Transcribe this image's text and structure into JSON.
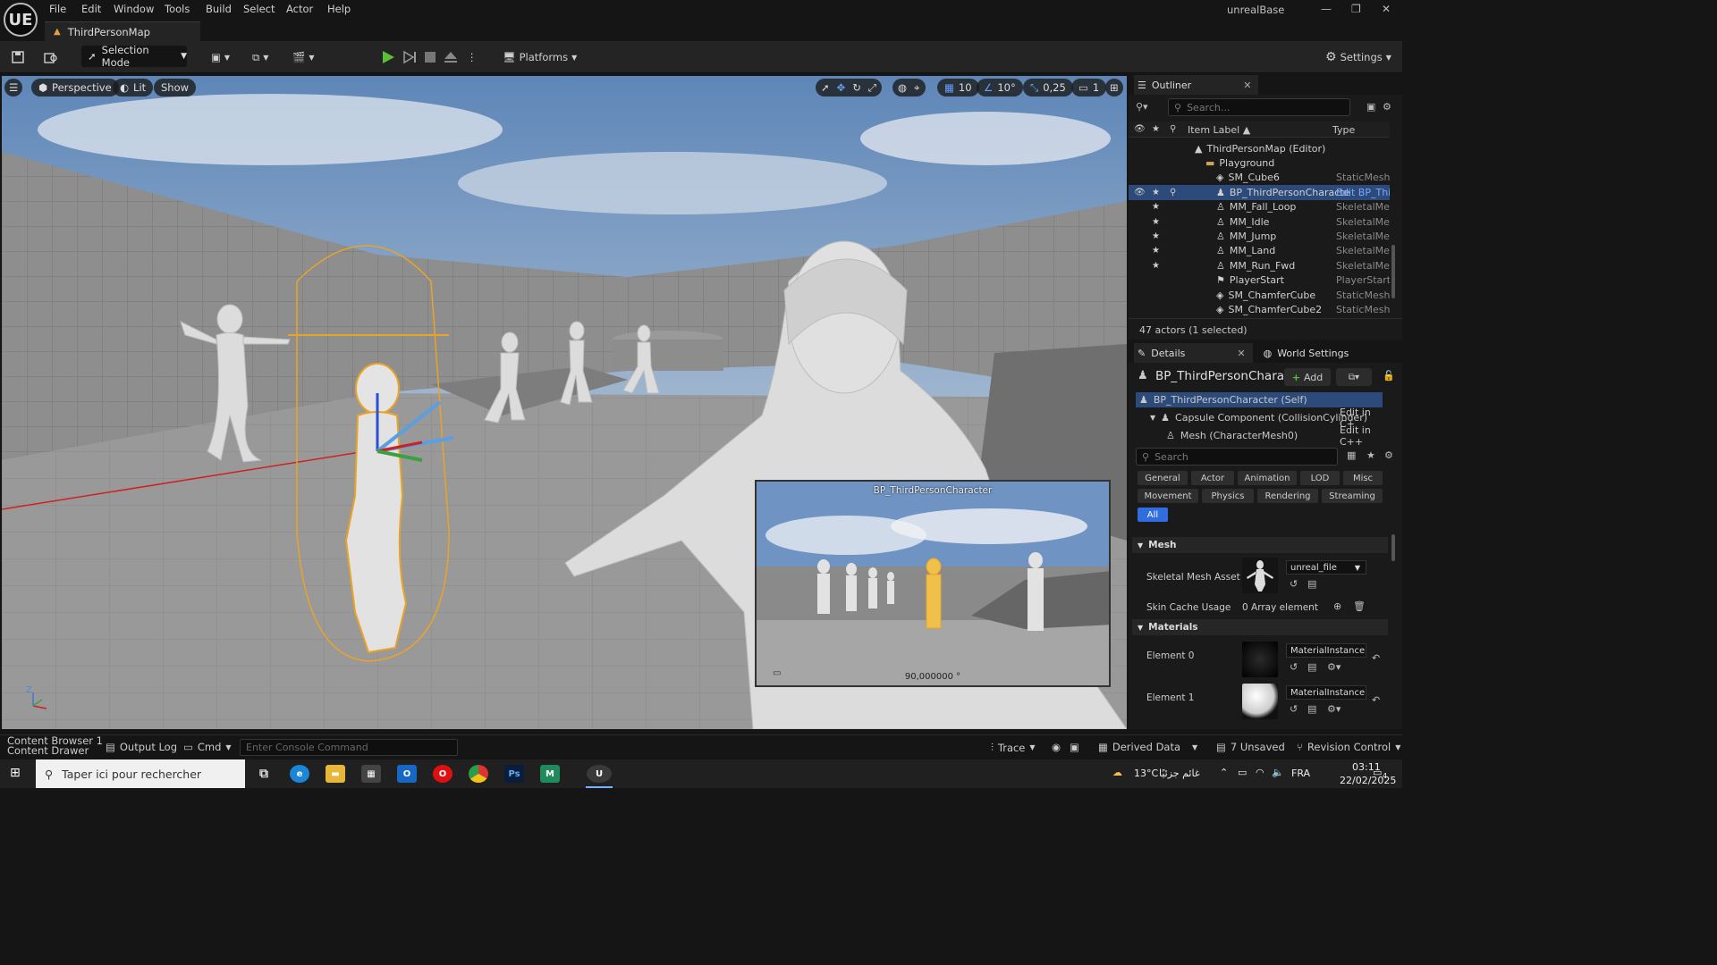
{
  "app": {
    "title": "unrealBase",
    "logo": "UE"
  },
  "menu": [
    "File",
    "Edit",
    "Window",
    "Tools",
    "Build",
    "Select",
    "Actor",
    "Help"
  ],
  "tab": {
    "label": "ThirdPersonMap"
  },
  "toolbar": {
    "selection_mode": "Selection Mode",
    "platforms": "Platforms",
    "settings": "Settings"
  },
  "viewport": {
    "perspective": "Perspective",
    "lit": "Lit",
    "show": "Show",
    "grid_snap": "10",
    "rot_snap": "10°",
    "scale_snap": "0,25",
    "camera_speed": "1",
    "pip_title": "BP_ThirdPersonCharacter",
    "pip_fov": "90,000000 °"
  },
  "outliner": {
    "title": "Outliner",
    "search_placeholder": "Search...",
    "col_label": "Item Label ▲",
    "col_type": "Type",
    "rows": [
      {
        "label": "ThirdPersonMap (Editor)",
        "type": "",
        "indent": 1,
        "icon": "▲"
      },
      {
        "label": "Playground",
        "type": "",
        "indent": 2,
        "icon": "▬",
        "folder": true
      },
      {
        "label": "SM_Cube6",
        "type": "StaticMeshA",
        "indent": 3,
        "icon": "◈"
      },
      {
        "label": "BP_ThirdPersonCharacte",
        "type": "Edit BP_Thir",
        "indent": 3,
        "icon": "♟",
        "selected": true
      },
      {
        "label": "MM_Fall_Loop",
        "type": "SkeletalMes",
        "indent": 3,
        "icon": "♙",
        "star": true
      },
      {
        "label": "MM_Idle",
        "type": "SkeletalMes",
        "indent": 3,
        "icon": "♙",
        "star": true
      },
      {
        "label": "MM_Jump",
        "type": "SkeletalMes",
        "indent": 3,
        "icon": "♙",
        "star": true
      },
      {
        "label": "MM_Land",
        "type": "SkeletalMes",
        "indent": 3,
        "icon": "♙",
        "star": true
      },
      {
        "label": "MM_Run_Fwd",
        "type": "SkeletalMes",
        "indent": 3,
        "icon": "♙",
        "star": true
      },
      {
        "label": "PlayerStart",
        "type": "PlayerStart",
        "indent": 3,
        "icon": "⚑"
      },
      {
        "label": "SM_ChamferCube",
        "type": "StaticMeshA",
        "indent": 3,
        "icon": "◈"
      },
      {
        "label": "SM_ChamferCube2",
        "type": "StaticMeshA",
        "indent": 3,
        "icon": "◈"
      }
    ],
    "footer": "47 actors (1 selected)"
  },
  "details": {
    "tab": "Details",
    "world_tab": "World Settings",
    "actor_name": "BP_ThirdPersonCharacte",
    "add_label": "Add",
    "components": [
      {
        "label": "BP_ThirdPersonCharacter (Self)",
        "edit": ""
      },
      {
        "label": "Capsule Component (CollisionCylinder)",
        "edit": "Edit in C+"
      },
      {
        "label": "Mesh (CharacterMesh0)",
        "edit": "Edit in C++"
      }
    ],
    "search_placeholder": "Search",
    "filters_row1": [
      "General",
      "Actor",
      "Animation",
      "LOD",
      "Misc"
    ],
    "filters_row2": [
      "Movement",
      "Physics",
      "Rendering",
      "Streaming"
    ],
    "filter_all": "All",
    "section_mesh": "Mesh",
    "skeletal_mesh_label": "Skeletal Mesh Asset",
    "skeletal_mesh_value": "unreal_file",
    "skin_cache_label": "Skin Cache Usage",
    "skin_cache_value": "0 Array element",
    "section_materials": "Materials",
    "element0_label": "Element 0",
    "element0_value": "MaterialInstanceDyna",
    "element1_label": "Element 1",
    "element1_value": "MaterialInstanceDyna"
  },
  "statusbar": {
    "content_browser": "Content Browser 1",
    "content_drawer": "Content Drawer",
    "output_log": "Output Log",
    "cmd": "Cmd",
    "console_placeholder": "Enter Console Command",
    "trace": "Trace",
    "derived_data": "Derived Data",
    "unsaved": "7 Unsaved",
    "revision_control": "Revision Control"
  },
  "taskbar": {
    "search_placeholder": "Taper ici pour rechercher",
    "weather": "13°C",
    "weather_text": "غائم جزئيًا",
    "lang": "FRA",
    "time": "03:11",
    "date": "22/02/2025",
    "notif_count": "4"
  },
  "colors": {
    "accent": "#3f72d6",
    "play_green": "#5bbf3a",
    "selection_orange": "#e9a428",
    "selected_row": "#2c4a7a"
  }
}
